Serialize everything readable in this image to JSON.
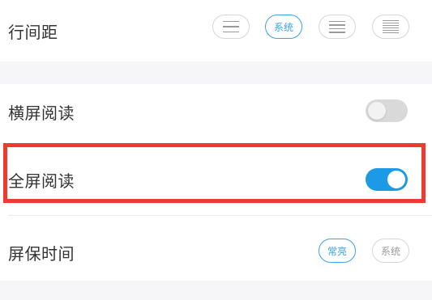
{
  "line_spacing": {
    "label": "行间距",
    "options": [
      {
        "name": "compact",
        "icon": "three-lines-icon"
      },
      {
        "name": "system",
        "text": "系统",
        "selected": true
      },
      {
        "name": "medium",
        "icon": "four-lines-icon"
      },
      {
        "name": "loose",
        "icon": "six-lines-icon"
      }
    ]
  },
  "landscape_reading": {
    "label": "横屏阅读",
    "enabled": false
  },
  "fullscreen_reading": {
    "label": "全屏阅读",
    "enabled": true
  },
  "screen_timeout": {
    "label": "屏保时间",
    "options": [
      {
        "text": "常亮",
        "selected": true
      },
      {
        "text": "系统",
        "selected": false
      }
    ]
  },
  "colors": {
    "accent": "#1c9ae6",
    "highlight_border": "#ee3b2f",
    "toggle_off": "#d9d9d9"
  }
}
